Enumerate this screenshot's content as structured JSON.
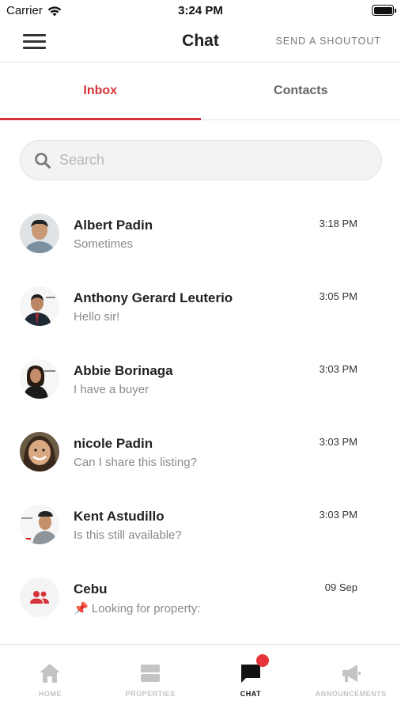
{
  "status_bar": {
    "carrier": "Carrier",
    "time": "3:24 PM"
  },
  "nav": {
    "title": "Chat",
    "shoutout_label": "SEND A SHOUTOUT"
  },
  "tabs": [
    {
      "label": "Inbox",
      "active": true
    },
    {
      "label": "Contacts",
      "active": false
    }
  ],
  "search": {
    "placeholder": "Search",
    "value": ""
  },
  "conversations": [
    {
      "name": "Albert Padin",
      "message": "Sometimes",
      "time": "3:18 PM"
    },
    {
      "name": "Anthony Gerard Leuterio",
      "message": "Hello sir!",
      "time": "3:05 PM"
    },
    {
      "name": "Abbie Borinaga",
      "message": "I have a buyer",
      "time": "3:03 PM"
    },
    {
      "name": "nicole Padin",
      "message": "Can I share this listing?",
      "time": "3:03 PM"
    },
    {
      "name": "Kent Astudillo",
      "message": "Is this still available?",
      "time": "3:03 PM"
    },
    {
      "name": "Cebu",
      "message": "📌 Looking for property:",
      "time": "09 Sep",
      "icon": "group-icon"
    }
  ],
  "bottom_tabs": [
    {
      "label": "HOME",
      "icon": "home-icon",
      "active": false
    },
    {
      "label": "PROPERTIES",
      "icon": "properties-icon",
      "active": false
    },
    {
      "label": "CHAT",
      "icon": "chat-icon",
      "active": true,
      "has_badge": true
    },
    {
      "label": "ANNOUNCEMENTS",
      "icon": "megaphone-icon",
      "active": false
    }
  ],
  "colors": {
    "accent": "#d6323a",
    "badge": "#e53338",
    "inactive": "#c4c4c4"
  }
}
